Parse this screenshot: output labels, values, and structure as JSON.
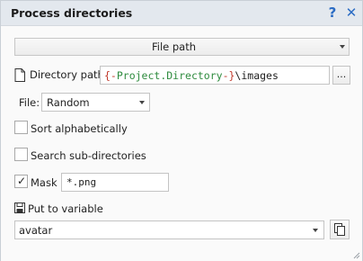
{
  "window": {
    "title": "Process directories",
    "help_symbol": "?",
    "close_symbol": "✕"
  },
  "source_type": {
    "selected": "File path"
  },
  "directory": {
    "label": "Directory path",
    "value_brace_open": "{-",
    "value_variable": "Project.Directory",
    "value_brace_close": "-}",
    "value_suffix": "\\images",
    "browse_label": "..."
  },
  "file": {
    "label": "File:",
    "selected": "Random"
  },
  "options": {
    "sort_label": "Sort alphabetically",
    "sort_checked": false,
    "subdirs_label": "Search sub-directories",
    "subdirs_checked": false,
    "mask_label": "Mask",
    "mask_checked": true,
    "mask_value": "*.png"
  },
  "output": {
    "label": "Put to variable",
    "variable": "avatar"
  },
  "icons": {
    "file_icon": "document-icon",
    "save_icon": "floppy-disk-icon",
    "copy_icon": "copy-icon",
    "help_icon": "question-mark-icon",
    "close_icon": "close-icon"
  },
  "colors": {
    "titlebar": "#e3e8ee",
    "accent_blue": "#2b6cc4",
    "brace_red": "#c0392b",
    "variable_green": "#2e8b3e"
  }
}
